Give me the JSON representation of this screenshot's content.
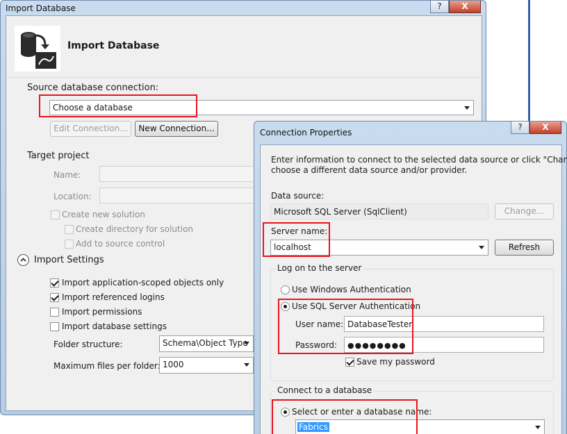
{
  "import_window": {
    "title": "Import Database",
    "help_button": "?",
    "close_button": "X",
    "header_title": "Import Database",
    "source_label": "Source database connection:",
    "source_combo_value": "Choose a database",
    "edit_connection_button": "Edit Connection...",
    "new_connection_button": "New Connection...",
    "target_project_label": "Target project",
    "name_label": "Name:",
    "location_label": "Location:",
    "create_new_solution": "Create new solution",
    "create_directory": "Create directory for solution",
    "add_to_source_control": "Add to source control",
    "import_settings_label": "Import Settings",
    "options": [
      {
        "label": "Import application-scoped objects only",
        "checked": true
      },
      {
        "label": "Import referenced logins",
        "checked": true
      },
      {
        "label": "Import permissions",
        "checked": false
      },
      {
        "label": "Import database settings",
        "checked": false
      }
    ],
    "folder_structure_label": "Folder structure:",
    "folder_structure_value": "Schema\\Object Type",
    "max_files_label": "Maximum files per folder:",
    "max_files_value": "1000"
  },
  "connection_window": {
    "title": "Connection Properties",
    "help_button": "?",
    "close_button": "X",
    "intro_text_line1": "Enter information to connect to the selected data source or click \"Change\" to",
    "intro_text_line2": "choose a different data source and/or provider.",
    "data_source_label": "Data source:",
    "data_source_value": "Microsoft SQL Server (SqlClient)",
    "change_button": "Change...",
    "server_name_label": "Server name:",
    "server_name_value": "localhost",
    "refresh_button": "Refresh",
    "logon_group_label": "Log on to the server",
    "windows_auth_label": "Use Windows Authentication",
    "sql_auth_label": "Use SQL Server Authentication",
    "user_name_label": "User name:",
    "user_name_value": "DatabaseTester",
    "password_label": "Password:",
    "password_value": "●●●●●●●●",
    "save_password_label": "Save my password",
    "connect_group_label": "Connect to a database",
    "select_db_label": "Select or enter a database name:",
    "database_value": "Fabrics"
  },
  "colors": {
    "highlight_red": "#e8141e",
    "selection_blue": "#3399ff"
  }
}
